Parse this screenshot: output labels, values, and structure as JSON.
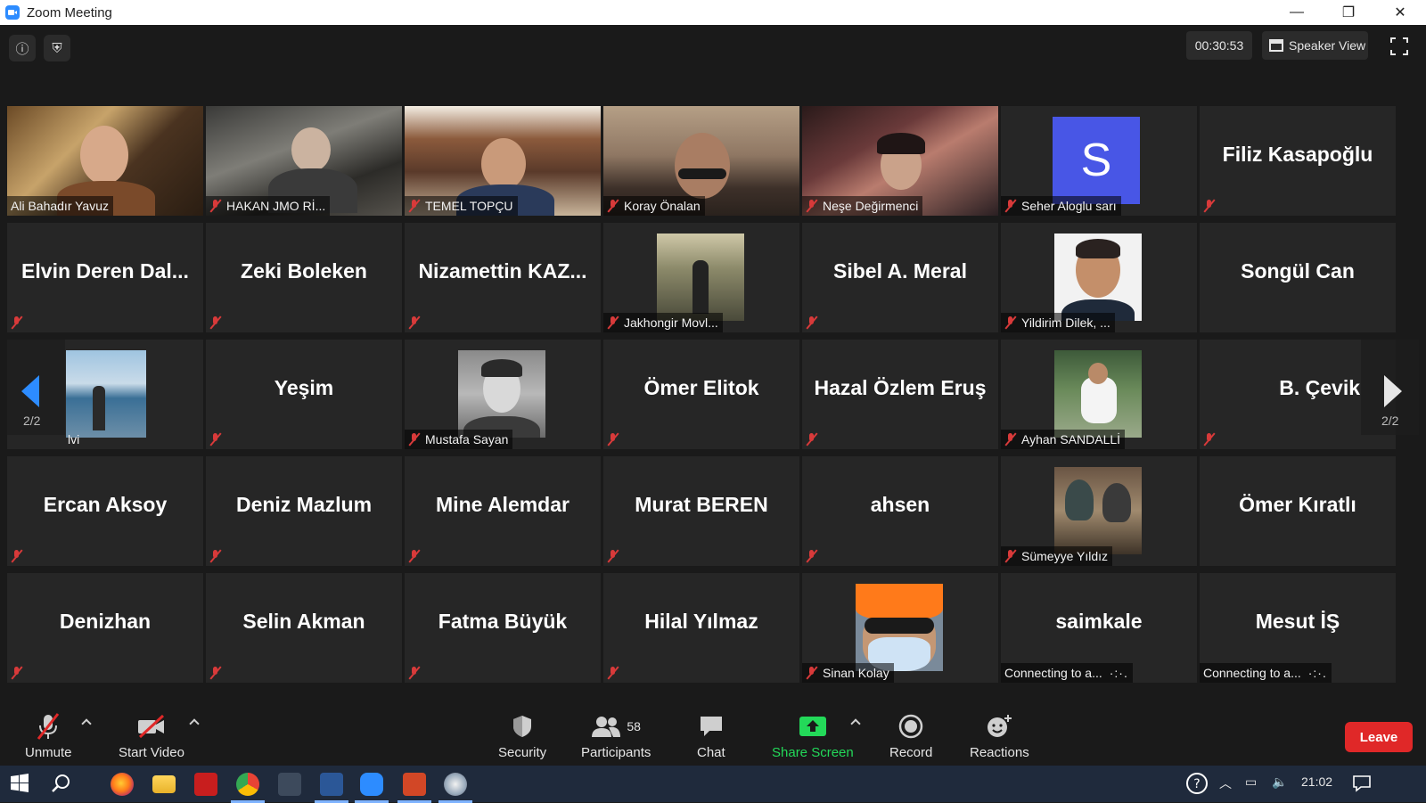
{
  "window": {
    "title": "Zoom Meeting",
    "controls": [
      "—",
      "❐",
      "✕"
    ]
  },
  "topbar": {
    "timer": "00:30:53",
    "speaker_view_label": "Speaker View"
  },
  "colors": {
    "accent": "#2d8cff",
    "share": "#23d959",
    "leave": "#e02828",
    "muted": "#d83a3a"
  },
  "tiles": [
    {
      "name": "Ali Bahadır Yavuz",
      "kind": "video",
      "muted": false
    },
    {
      "name": "HAKAN JMO Rİ...",
      "kind": "video",
      "muted": true
    },
    {
      "name": "TEMEL TOPÇU",
      "kind": "video",
      "muted": true
    },
    {
      "name": "Koray Önalan",
      "kind": "video",
      "muted": true
    },
    {
      "name": "Neşe Değirmenci",
      "kind": "video",
      "muted": true
    },
    {
      "name": "Seher Aloglu sarı",
      "kind": "avatar",
      "initial": "S",
      "muted": true
    },
    {
      "name": "Filiz Kasapoğlu",
      "kind": "text",
      "muted": true
    },
    {
      "name": "Elvin Deren Dal...",
      "kind": "text",
      "muted": true
    },
    {
      "name": "Zeki Boleken",
      "kind": "text",
      "muted": true
    },
    {
      "name": "Nizamettin KAZ...",
      "kind": "text",
      "muted": true
    },
    {
      "name": "Jakhongir Movl...",
      "kind": "photo",
      "muted": true
    },
    {
      "name": "Sibel A. Meral",
      "kind": "text",
      "muted": true
    },
    {
      "name": "Yildirim Dilek, ...",
      "kind": "photo",
      "muted": true
    },
    {
      "name": "Songül Can",
      "kind": "text",
      "muted": false
    },
    {
      "name": "lvi",
      "kind": "photo",
      "muted": false
    },
    {
      "name": "Yeşim",
      "kind": "text",
      "muted": true
    },
    {
      "name": "Mustafa Sayan",
      "kind": "photo",
      "muted": true
    },
    {
      "name": "Ömer Elitok",
      "kind": "text",
      "muted": true
    },
    {
      "name": "Hazal Özlem Eruş",
      "kind": "text",
      "muted": true
    },
    {
      "name": "Ayhan SANDALLİ",
      "kind": "photo",
      "muted": true
    },
    {
      "name": "B. Çevik",
      "kind": "text",
      "muted": true
    },
    {
      "name": "Ercan Aksoy",
      "kind": "text",
      "muted": true
    },
    {
      "name": "Deniz Mazlum",
      "kind": "text",
      "muted": true
    },
    {
      "name": "Mine Alemdar",
      "kind": "text",
      "muted": true
    },
    {
      "name": "Murat BEREN",
      "kind": "text",
      "muted": true
    },
    {
      "name": "ahsen",
      "kind": "text",
      "muted": true
    },
    {
      "name": "Sümeyye Yıldız",
      "kind": "photo",
      "muted": true
    },
    {
      "name": "Ömer Kıratlı",
      "kind": "text",
      "muted": false
    },
    {
      "name": "Denizhan",
      "kind": "text",
      "muted": true
    },
    {
      "name": "Selin Akman",
      "kind": "text",
      "muted": true
    },
    {
      "name": "Fatma Büyük",
      "kind": "text",
      "muted": true
    },
    {
      "name": "Hilal Yılmaz",
      "kind": "text",
      "muted": true
    },
    {
      "name": "Sinan Kolay",
      "kind": "photo",
      "muted": true
    },
    {
      "name": "saimkale",
      "kind": "text",
      "status": "Connecting to a...",
      "muted": false
    },
    {
      "name": "Mesut İŞ",
      "kind": "text",
      "status": "Connecting to a...",
      "muted": false
    }
  ],
  "pagination": {
    "left": "2/2",
    "right": "2/2"
  },
  "toolbar": {
    "unmute": "Unmute",
    "start_video": "Start Video",
    "security": "Security",
    "participants": "Participants",
    "participants_count": "58",
    "chat": "Chat",
    "share_screen": "Share Screen",
    "record": "Record",
    "reactions": "Reactions",
    "leave": "Leave"
  },
  "taskbar": {
    "apps": [
      "start-icon",
      "search-icon",
      "firefox-icon",
      "file-explorer-icon",
      "acrobat-icon",
      "chrome-icon",
      "app-icon",
      "word-icon",
      "zoom-icon",
      "powerpoint-icon",
      "paint-icon"
    ],
    "clock": "21:02"
  }
}
